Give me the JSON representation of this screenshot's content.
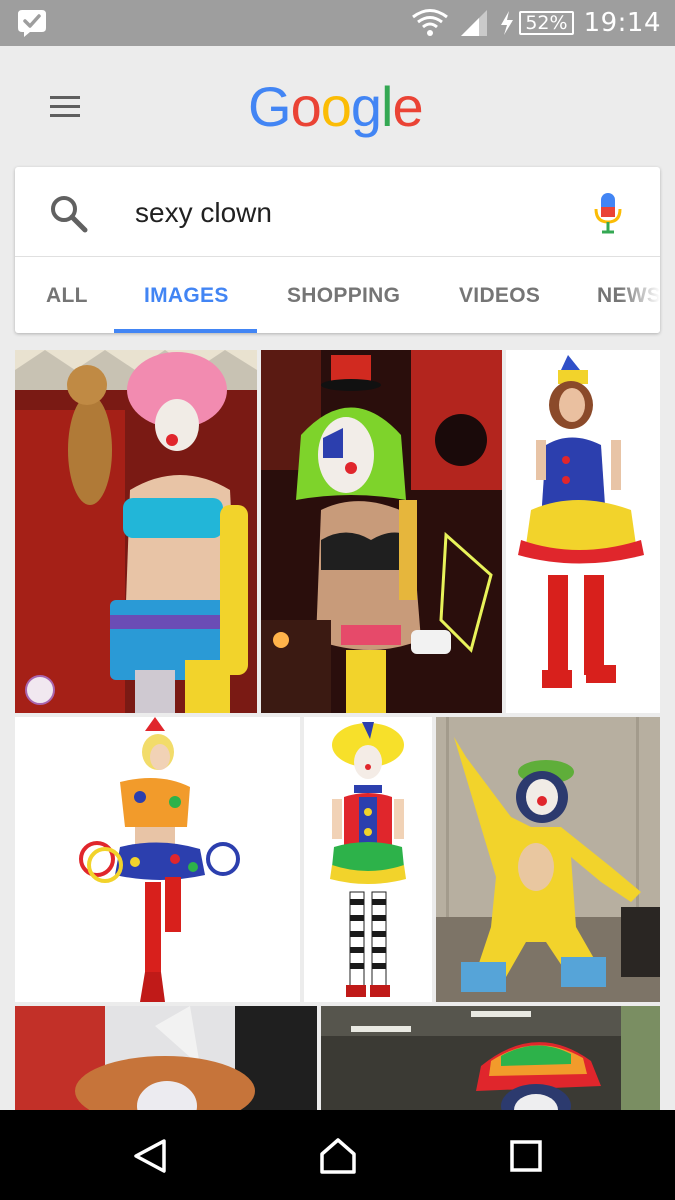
{
  "status_bar": {
    "time": "19:14",
    "battery_percent": "52%",
    "icons": [
      "app-notification-icon",
      "wifi-icon",
      "cell-signal-icon",
      "charging-bolt-icon",
      "battery-icon"
    ]
  },
  "header": {
    "logo_letters": [
      {
        "char": "G",
        "color": "#4285f4"
      },
      {
        "char": "o",
        "color": "#ea4335"
      },
      {
        "char": "o",
        "color": "#fbbc05"
      },
      {
        "char": "g",
        "color": "#4285f4"
      },
      {
        "char": "l",
        "color": "#34a853"
      },
      {
        "char": "e",
        "color": "#ea4335"
      }
    ]
  },
  "search": {
    "query": "sexy clown"
  },
  "tabs": [
    {
      "label": "ALL",
      "active": false
    },
    {
      "label": "IMAGES",
      "active": true
    },
    {
      "label": "SHOPPING",
      "active": false
    },
    {
      "label": "VIDEOS",
      "active": false
    },
    {
      "label": "NEWS",
      "active": false
    }
  ],
  "results": [
    {
      "description": "clown with pink wig and blue top"
    },
    {
      "description": "clown with green wig and red hat"
    },
    {
      "description": "clown costume blue dress red boots"
    },
    {
      "description": "clown costume with hoops"
    },
    {
      "description": "clown costume striped stockings"
    },
    {
      "description": "man in yellow clown suit"
    },
    {
      "description": "clown with orange wig"
    },
    {
      "description": "clown with colorful hat"
    }
  ],
  "colors": {
    "accent": "#4285f4",
    "status_bar": "#9e9e9e",
    "background": "#ececec"
  },
  "nav": {
    "icons": [
      "back-icon",
      "home-icon",
      "recents-icon"
    ]
  }
}
